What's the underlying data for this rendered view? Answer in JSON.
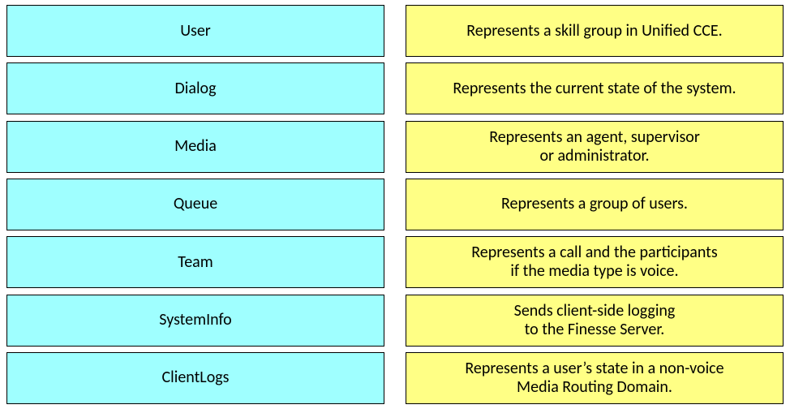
{
  "pairs": [
    {
      "term": "User",
      "desc": "Represents a skill group in Unified CCE."
    },
    {
      "term": "Dialog",
      "desc": "Represents the current state of the system."
    },
    {
      "term": "Media",
      "desc": "Represents an agent, supervisor\nor administrator."
    },
    {
      "term": "Queue",
      "desc": "Represents a group of users."
    },
    {
      "term": "Team",
      "desc": "Represents a call and the participants\nif the media type is voice."
    },
    {
      "term": "SystemInfo",
      "desc": "Sends client-side logging\nto the Finesse Server."
    },
    {
      "term": "ClientLogs",
      "desc": "Represents a user’s state in a non-voice\nMedia Routing Domain."
    }
  ]
}
